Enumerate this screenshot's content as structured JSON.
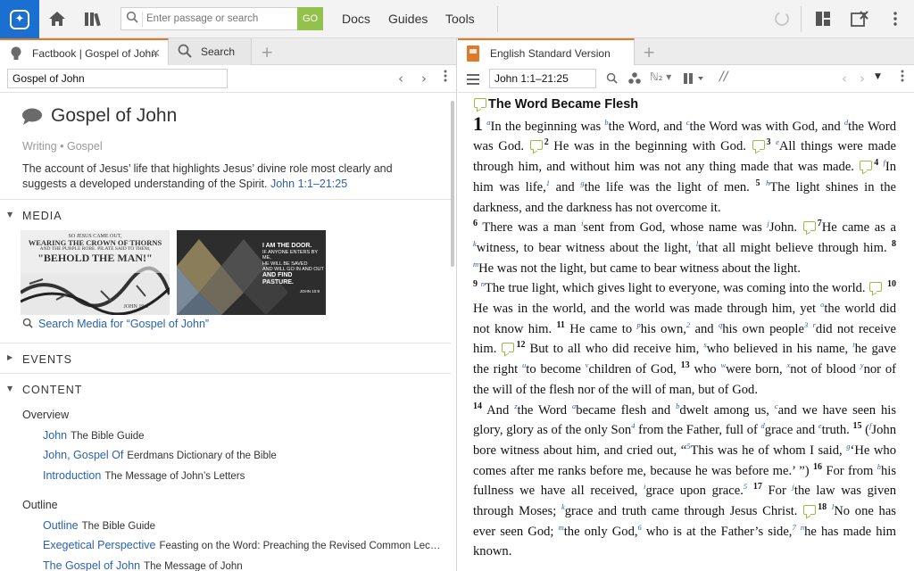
{
  "toolbar": {
    "search_placeholder": "Enter passage or search",
    "go_label": "GO",
    "menu": [
      "Docs",
      "Guides",
      "Tools"
    ]
  },
  "left": {
    "tabs": [
      {
        "label": "Factbook | Gospel of John"
      },
      {
        "label": "Search"
      }
    ],
    "reference": "Gospel of John",
    "title": "Gospel of John",
    "type": "Writing • Gospel",
    "description": "The account of Jesus’ life that highlights Jesus’ divine role most clearly and suggests a developed understanding of the Spirit.",
    "description_link": "John 1:1–21:25",
    "sections": {
      "media": "MEDIA",
      "events": "EVENTS",
      "content": "CONTENT"
    },
    "media_images": [
      {
        "lines": [
          "SO JESUS CAME OUT,",
          "WEARING THE CROWN OF THORNS",
          "AND THE PURPLE ROBE. PILATE SAID TO THEM,",
          "\"BEHOLD THE MAN!\"",
          "JOHN 19:5"
        ]
      },
      {
        "lines": [
          "I AM THE DOOR.",
          "IF ANYONE ENTERS BY ME,",
          "HE WILL BE SAVED",
          "AND WILL GO IN AND OUT",
          "AND FIND PASTURE.",
          "JOHN 10:9"
        ]
      }
    ],
    "media_search": "Search Media for “Gospel of John”",
    "content": {
      "overview_label": "Overview",
      "overview": [
        {
          "link": "John",
          "source": "The Bible Guide"
        },
        {
          "link": "John, Gospel Of",
          "source": "Eerdmans Dictionary of the Bible"
        },
        {
          "link": "Introduction",
          "source": "The Message of John’s Letters"
        }
      ],
      "outline_label": "Outline",
      "outline": [
        {
          "link": "Outline",
          "source": "The Bible Guide"
        },
        {
          "link": "Exegetical Perspective",
          "source": "Feasting on the Word: Preaching the Revised Common Lec…"
        },
        {
          "link": "The Gospel of John",
          "source": "The Message of John"
        }
      ]
    }
  },
  "right": {
    "tab_label": "English Standard Version",
    "reference": "John 1:1–21:25",
    "heading": "The Word Became Flesh"
  }
}
